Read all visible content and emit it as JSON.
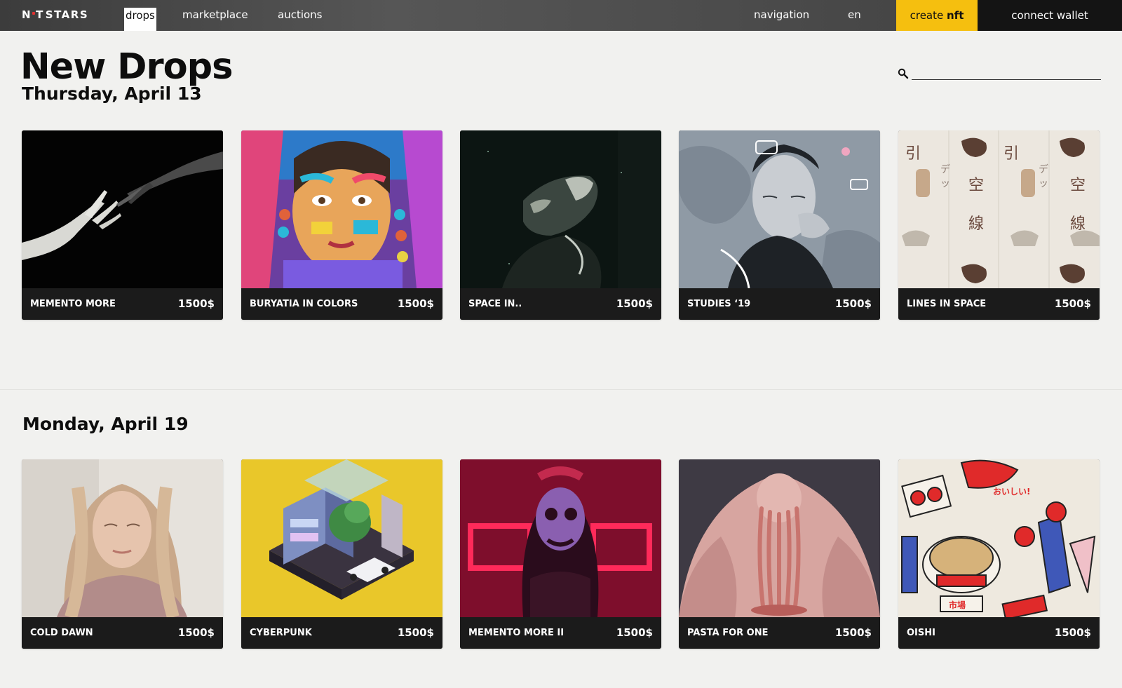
{
  "nav": {
    "logo": "STARS",
    "logo_mark": "N",
    "links": [
      "drops",
      "marketplace",
      "auctions"
    ],
    "navigation": "navigation",
    "language": "en",
    "create_label_a": "create ",
    "create_label_b": "nft",
    "connect_wallet": "connect wallet"
  },
  "page": {
    "title": "New Drops",
    "search_placeholder": ""
  },
  "sections": [
    {
      "date": "Thursday, April 13",
      "items": [
        {
          "title": "MEMENTO MORE",
          "price": "1500$",
          "image": "hands-artwork"
        },
        {
          "title": "BURYATIA IN COLORS",
          "price": "1500$",
          "image": "painted-girl-portrait"
        },
        {
          "title": "SPACE IN..",
          "price": "1500$",
          "image": "astronaut-dark-photo"
        },
        {
          "title": "STUDIES ‘19",
          "price": "1500$",
          "image": "illustrated-man-portrait"
        },
        {
          "title": "LINES IN SPACE",
          "price": "1500$",
          "image": "japanese-posters"
        }
      ]
    },
    {
      "date": "Monday, April 19",
      "items": [
        {
          "title": "COLD DAWN",
          "price": "1500$",
          "image": "girl-portrait-photo"
        },
        {
          "title": "CYBERPUNK",
          "price": "1500$",
          "image": "isometric-building"
        },
        {
          "title": "MEMENTO MORE II",
          "price": "1500$",
          "image": "neon-skull-figure"
        },
        {
          "title": "PASTA FOR ONE",
          "price": "1500$",
          "image": "pasta-sculpture"
        },
        {
          "title": "OISHI",
          "price": "1500$",
          "image": "japanese-food-illustration"
        }
      ]
    }
  ],
  "colors": {
    "accent": "#f5bf0f",
    "topbar": "#4a4a4a",
    "card": "#1b1b1b",
    "background": "#f1f1ef"
  }
}
